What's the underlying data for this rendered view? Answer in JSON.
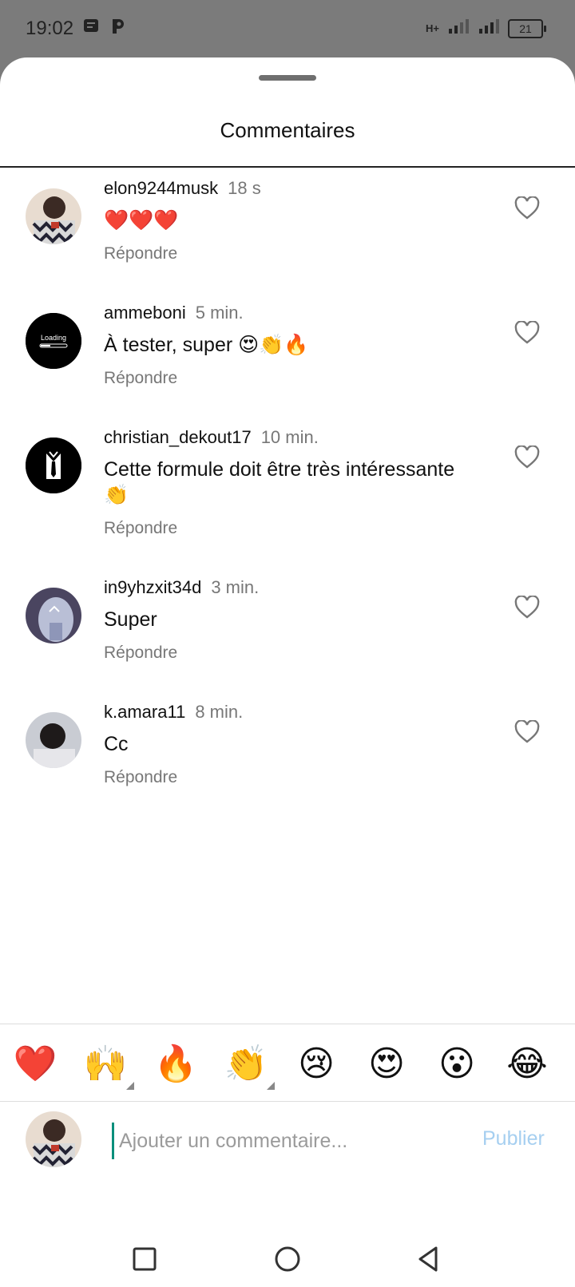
{
  "status_bar": {
    "time": "19:02",
    "network": "H+",
    "battery": "21",
    "icons": [
      "notes-icon",
      "p-app-icon",
      "signal-icon",
      "signal-icon",
      "battery-icon"
    ]
  },
  "sheet": {
    "title": "Commentaires"
  },
  "comments": [
    {
      "user": "elon9244musk",
      "time": "18 s",
      "text": "❤️❤️❤️",
      "reply": "Répondre"
    },
    {
      "user": "ammeboni",
      "time": "5 min.",
      "text": "À tester, super 😍👏🔥",
      "reply": "Répondre",
      "avatar_text": "Loading"
    },
    {
      "user": "christian_dekout17",
      "time": "10 min.",
      "text": "Cette formule doit être très intéressante 👏",
      "reply": "Répondre"
    },
    {
      "user": "in9yhzxit34d",
      "time": "3 min.",
      "text": "Super",
      "reply": "Répondre"
    },
    {
      "user": "k.amara11",
      "time": "8 min.",
      "text": "Cc",
      "reply": "Répondre"
    }
  ],
  "emoji_bar": [
    "❤️",
    "🙌",
    "🔥",
    "👏",
    "😢",
    "😍",
    "😮",
    "😂"
  ],
  "composer": {
    "placeholder": "Ajouter un commentaire...",
    "publish_label": "Publier"
  },
  "colors": {
    "accent_cursor": "#0a8f7c",
    "publish_disabled": "#a6cff0",
    "muted_text": "#777777"
  }
}
